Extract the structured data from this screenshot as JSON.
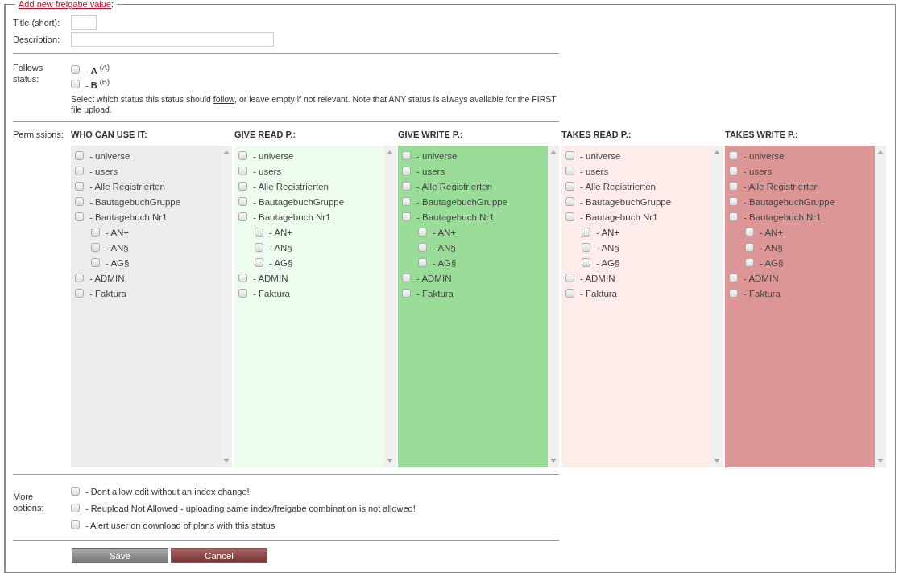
{
  "legend": "Add new freigabe value",
  "legend_suffix": ":",
  "fields": [
    {
      "label": "Title (short):",
      "kind": "short"
    },
    {
      "label": "Description:",
      "kind": "long"
    }
  ],
  "follows": {
    "label": "Follows status:",
    "options": [
      {
        "label": "- **A** $^{(A)}$",
        "checked": false
      },
      {
        "label": "- **B** $^{(B)}$",
        "checked": false
      }
    ],
    "note_before": "Select which status this status should ",
    "note_link": "follow",
    "note_after": ", or leave empty if not relevant. Note that ANY status is always available for the FIRST file upload."
  },
  "permissions": {
    "label": "Permissions:",
    "columns": [
      {
        "heading": "WHO CAN USE IT:",
        "color": "#ececec",
        "items": [
          {
            "label": "- universe",
            "checked": false
          },
          {
            "label": "- users",
            "checked": false
          },
          {
            "label": "- Alle Registrierten",
            "checked": false
          },
          {
            "label": "- BautagebuchGruppe",
            "checked": false
          },
          {
            "label": "- Bautagebuch Nr1",
            "checked": false,
            "children": [
              {
                "label": "- AN+",
                "checked": false
              },
              {
                "label": "- AN§",
                "checked": false
              },
              {
                "label": "- AG§",
                "checked": false
              }
            ]
          },
          {
            "label": "- ADMIN",
            "checked": false
          },
          {
            "label": "- Faktura",
            "checked": false
          }
        ]
      },
      {
        "heading": "GIVE READ P.:",
        "color": "#edfded",
        "items": [
          {
            "label": "- universe",
            "checked": false
          },
          {
            "label": "- users",
            "checked": false
          },
          {
            "label": "- Alle Registrierten",
            "checked": false
          },
          {
            "label": "- BautagebuchGruppe",
            "checked": false
          },
          {
            "label": "- Bautagebuch Nr1",
            "checked": false,
            "children": [
              {
                "label": "- AN+",
                "checked": false
              },
              {
                "label": "- AN§",
                "checked": false
              },
              {
                "label": "- AG§",
                "checked": false
              }
            ]
          },
          {
            "label": "- ADMIN",
            "checked": false
          },
          {
            "label": "- Faktura",
            "checked": false
          }
        ]
      },
      {
        "heading": "GIVE WRITE P.:",
        "color": "#99dd99",
        "items": [
          {
            "label": "- universe",
            "checked": false
          },
          {
            "label": "- users",
            "checked": false
          },
          {
            "label": "- Alle Registrierten",
            "checked": false
          },
          {
            "label": "- BautagebuchGruppe",
            "checked": false
          },
          {
            "label": "- Bautagebuch Nr1",
            "checked": false,
            "children": [
              {
                "label": "- AN+",
                "checked": false
              },
              {
                "label": "- AN§",
                "checked": false
              },
              {
                "label": "- AG§",
                "checked": false
              }
            ]
          },
          {
            "label": "- ADMIN",
            "checked": false
          },
          {
            "label": "- Faktura",
            "checked": false
          }
        ]
      },
      {
        "heading": "TAKES READ P.:",
        "color": "#fdecea",
        "items": [
          {
            "label": "- universe",
            "checked": false
          },
          {
            "label": "- users",
            "checked": false
          },
          {
            "label": "- Alle Registrierten",
            "checked": false
          },
          {
            "label": "- BautagebuchGruppe",
            "checked": false
          },
          {
            "label": "- Bautagebuch Nr1",
            "checked": false,
            "children": [
              {
                "label": "- AN+",
                "checked": false
              },
              {
                "label": "- AN§",
                "checked": false
              },
              {
                "label": "- AG§",
                "checked": false
              }
            ]
          },
          {
            "label": "- ADMIN",
            "checked": false
          },
          {
            "label": "- Faktura",
            "checked": false
          }
        ]
      },
      {
        "heading": "TAKES WRITE P.:",
        "color": "#dd9696",
        "items": [
          {
            "label": "- universe",
            "checked": false
          },
          {
            "label": "- users",
            "checked": false
          },
          {
            "label": "- Alle Registrierten",
            "checked": false
          },
          {
            "label": "- BautagebuchGruppe",
            "checked": false
          },
          {
            "label": "- Bautagebuch Nr1",
            "checked": false,
            "children": [
              {
                "label": "- AN+",
                "checked": false
              },
              {
                "label": "- AN§",
                "checked": false
              },
              {
                "label": "- AG§",
                "checked": false
              }
            ]
          },
          {
            "label": "- ADMIN",
            "checked": false
          },
          {
            "label": "- Faktura",
            "checked": false
          }
        ]
      }
    ]
  },
  "more": {
    "label": "More options:",
    "options": [
      {
        "label": "- Dont allow edit without an index change!",
        "checked": false
      },
      {
        "label": "- Reupload Not Allowed - uploading same index/freigabe combination is not allowed!",
        "checked": false
      },
      {
        "label": "- Alert user on download of plans with this status",
        "checked": false
      }
    ]
  },
  "buttons": [
    {
      "label": "Save",
      "kind": "save"
    },
    {
      "label": "Cancel",
      "kind": "cancel"
    }
  ]
}
